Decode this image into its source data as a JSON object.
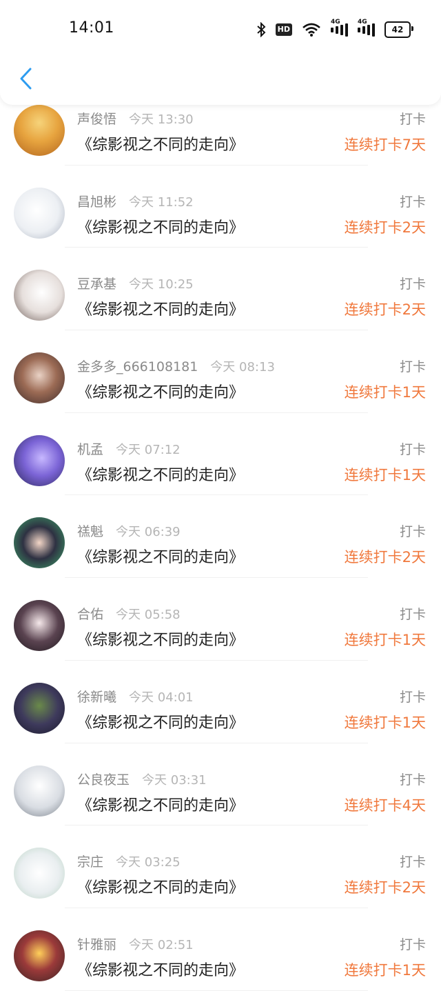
{
  "status_bar": {
    "time": "14:01",
    "battery": "42",
    "hd_label": "HD",
    "signal_label": "4G",
    "icons": [
      "bluetooth-icon",
      "hd-icon",
      "wifi-icon",
      "signal-4g-icon",
      "signal-4g-icon",
      "battery-icon"
    ]
  },
  "nav": {
    "back_icon": "chevron-left-icon",
    "accent": "#2d9cf0"
  },
  "colors": {
    "streak": "#f0783c",
    "meta": "#8a8a8a",
    "time": "#b5b5b5"
  },
  "entries": [
    {
      "name": "声俊悟",
      "time": "今天 13:30",
      "book": "《综影视之不同的走向》",
      "action": "打卡",
      "streak": "连续打卡7天"
    },
    {
      "name": "昌旭彬",
      "time": "今天 11:52",
      "book": "《综影视之不同的走向》",
      "action": "打卡",
      "streak": "连续打卡2天"
    },
    {
      "name": "豆承基",
      "time": "今天 10:25",
      "book": "《综影视之不同的走向》",
      "action": "打卡",
      "streak": "连续打卡2天"
    },
    {
      "name": "金多多_666108181",
      "time": "今天 08:13",
      "book": "《综影视之不同的走向》",
      "action": "打卡",
      "streak": "连续打卡1天"
    },
    {
      "name": "机孟",
      "time": "今天 07:12",
      "book": "《综影视之不同的走向》",
      "action": "打卡",
      "streak": "连续打卡1天"
    },
    {
      "name": "禚魁",
      "time": "今天 06:39",
      "book": "《综影视之不同的走向》",
      "action": "打卡",
      "streak": "连续打卡2天"
    },
    {
      "name": "合佑",
      "time": "今天 05:58",
      "book": "《综影视之不同的走向》",
      "action": "打卡",
      "streak": "连续打卡1天"
    },
    {
      "name": "徐新曦",
      "time": "今天 04:01",
      "book": "《综影视之不同的走向》",
      "action": "打卡",
      "streak": "连续打卡1天"
    },
    {
      "name": "公良夜玉",
      "time": "今天 03:31",
      "book": "《综影视之不同的走向》",
      "action": "打卡",
      "streak": "连续打卡4天"
    },
    {
      "name": "宗庄",
      "time": "今天 03:25",
      "book": "《综影视之不同的走向》",
      "action": "打卡",
      "streak": "连续打卡2天"
    },
    {
      "name": "针雅丽",
      "time": "今天 02:51",
      "book": "《综影视之不同的走向》",
      "action": "打卡",
      "streak": "连续打卡1天"
    }
  ]
}
